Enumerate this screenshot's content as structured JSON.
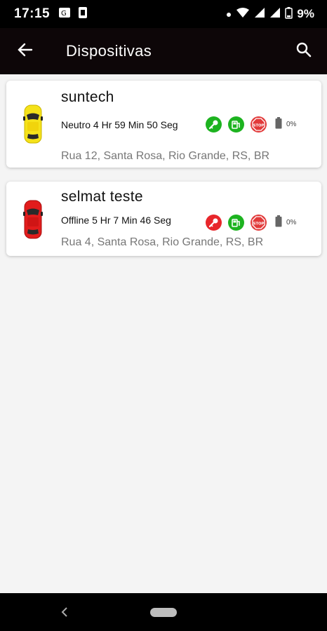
{
  "status_bar": {
    "time": "17:15",
    "battery_percent": "9%",
    "icons": [
      "translate-icon",
      "sim-icon",
      "dot-icon",
      "wifi-icon",
      "signal-icon",
      "signal-icon",
      "battery-icon"
    ]
  },
  "app_bar": {
    "title": "Dispositivas",
    "back_icon": "arrow-left-icon",
    "search_icon": "search-icon"
  },
  "colors": {
    "app_bar_bg": "#0d0608",
    "green_badge": "#1db320",
    "red_badge": "#e8262b",
    "stop_badge": "#e23a3a",
    "car_yellow": "#f5e21a",
    "car_red": "#e21c1c"
  },
  "devices": [
    {
      "name": "suntech",
      "status": "Neutro 4 Hr 59 Min 50 Seg",
      "address": "Rua 12, Santa Rosa, Rio Grande, RS, BR",
      "car_color": "yellow",
      "ignition": "on",
      "battery": "0%"
    },
    {
      "name": "selmat teste",
      "status": "Offline 5 Hr 7 Min 46 Seg",
      "address": "Rua 4, Santa Rosa, Rio Grande, RS, BR",
      "car_color": "red",
      "ignition": "off",
      "battery": "0%"
    }
  ]
}
